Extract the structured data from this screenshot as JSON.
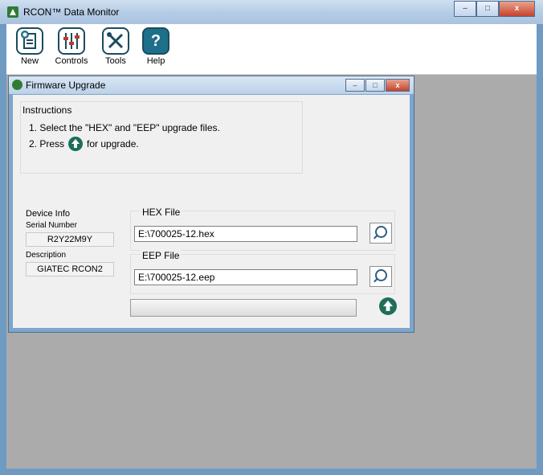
{
  "window": {
    "title": "RCON™ Data Monitor",
    "controls": {
      "minimize": "–",
      "maximize": "□",
      "close": "x"
    }
  },
  "toolbar": {
    "items": [
      {
        "label": "New",
        "icon": "new-document-icon"
      },
      {
        "label": "Controls",
        "icon": "sliders-icon"
      },
      {
        "label": "Tools",
        "icon": "tools-icon"
      },
      {
        "label": "Help",
        "icon": "help-icon",
        "glyph": "?"
      }
    ]
  },
  "dialog": {
    "title": "Firmware Upgrade",
    "controls": {
      "minimize": "–",
      "maximize": "□",
      "close": "x"
    },
    "instructions": {
      "title": "Instructions",
      "step1": "1. Select the \"HEX\" and \"EEP\" upgrade files.",
      "step2_prefix": "2. Press",
      "step2_suffix": "for upgrade."
    },
    "device_info": {
      "title": "Device Info",
      "serial_label": "Serial Number",
      "serial_value": "R2Y22M9Y",
      "description_label": "Description",
      "description_value": "GIATEC RCON2"
    },
    "hex_file": {
      "label": "HEX File",
      "value": "E:\\700025-12.hex"
    },
    "eep_file": {
      "label": "EEP File",
      "value": "E:\\700025-12.eep"
    },
    "progress": {
      "value": 0
    }
  },
  "colors": {
    "frame": "#6f9ac2",
    "workspace": "#ababab",
    "accent_green": "#1f6e5a"
  }
}
